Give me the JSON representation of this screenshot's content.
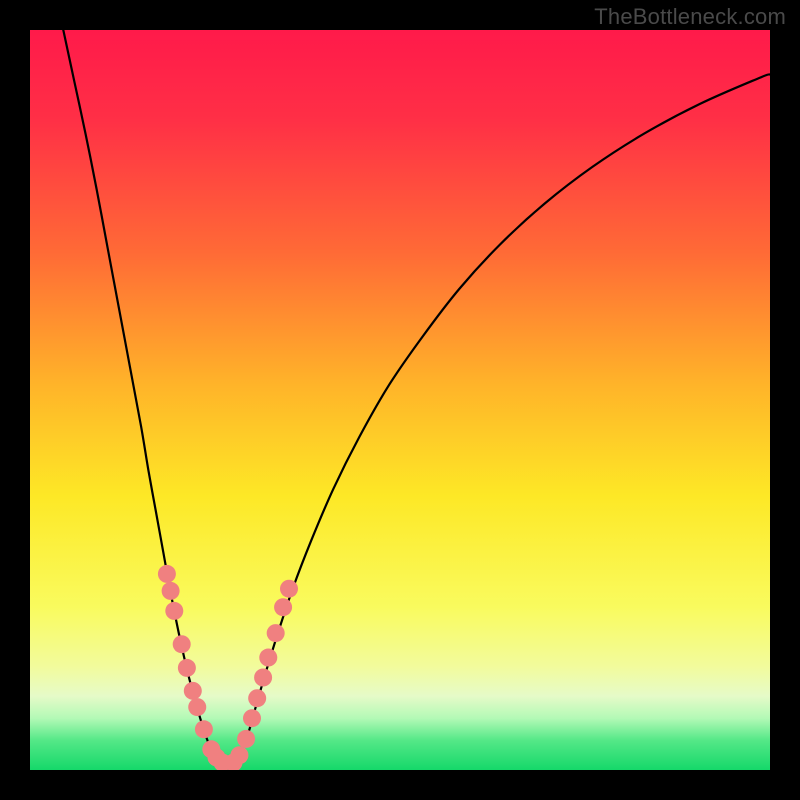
{
  "watermark": "TheBottleneck.com",
  "gradient_stops": [
    {
      "offset": 0.0,
      "color": "#ff1a4a"
    },
    {
      "offset": 0.12,
      "color": "#ff2f46"
    },
    {
      "offset": 0.3,
      "color": "#ff6a36"
    },
    {
      "offset": 0.48,
      "color": "#ffb429"
    },
    {
      "offset": 0.63,
      "color": "#fde826"
    },
    {
      "offset": 0.78,
      "color": "#f9fb5e"
    },
    {
      "offset": 0.86,
      "color": "#f2fb9c"
    },
    {
      "offset": 0.9,
      "color": "#e6fbc8"
    },
    {
      "offset": 0.93,
      "color": "#b3f9b6"
    },
    {
      "offset": 0.96,
      "color": "#54e887"
    },
    {
      "offset": 1.0,
      "color": "#15d86a"
    }
  ],
  "curves": {
    "left": {
      "name": "left-branch",
      "points": [
        {
          "x": 0.045,
          "y": 0.0
        },
        {
          "x": 0.06,
          "y": 0.07
        },
        {
          "x": 0.075,
          "y": 0.14
        },
        {
          "x": 0.09,
          "y": 0.215
        },
        {
          "x": 0.105,
          "y": 0.295
        },
        {
          "x": 0.12,
          "y": 0.375
        },
        {
          "x": 0.135,
          "y": 0.455
        },
        {
          "x": 0.15,
          "y": 0.535
        },
        {
          "x": 0.16,
          "y": 0.595
        },
        {
          "x": 0.17,
          "y": 0.65
        },
        {
          "x": 0.18,
          "y": 0.705
        },
        {
          "x": 0.19,
          "y": 0.76
        },
        {
          "x": 0.2,
          "y": 0.81
        },
        {
          "x": 0.21,
          "y": 0.855
        },
        {
          "x": 0.22,
          "y": 0.895
        },
        {
          "x": 0.23,
          "y": 0.93
        },
        {
          "x": 0.238,
          "y": 0.955
        },
        {
          "x": 0.245,
          "y": 0.972
        },
        {
          "x": 0.252,
          "y": 0.983
        },
        {
          "x": 0.26,
          "y": 0.99
        }
      ]
    },
    "right": {
      "name": "right-branch",
      "points": [
        {
          "x": 0.275,
          "y": 0.99
        },
        {
          "x": 0.285,
          "y": 0.975
        },
        {
          "x": 0.295,
          "y": 0.95
        },
        {
          "x": 0.305,
          "y": 0.915
        },
        {
          "x": 0.318,
          "y": 0.87
        },
        {
          "x": 0.335,
          "y": 0.815
        },
        {
          "x": 0.355,
          "y": 0.755
        },
        {
          "x": 0.38,
          "y": 0.69
        },
        {
          "x": 0.41,
          "y": 0.62
        },
        {
          "x": 0.445,
          "y": 0.55
        },
        {
          "x": 0.485,
          "y": 0.48
        },
        {
          "x": 0.53,
          "y": 0.415
        },
        {
          "x": 0.58,
          "y": 0.35
        },
        {
          "x": 0.635,
          "y": 0.29
        },
        {
          "x": 0.695,
          "y": 0.235
        },
        {
          "x": 0.76,
          "y": 0.185
        },
        {
          "x": 0.83,
          "y": 0.14
        },
        {
          "x": 0.905,
          "y": 0.1
        },
        {
          "x": 0.985,
          "y": 0.065
        },
        {
          "x": 1.0,
          "y": 0.06
        }
      ]
    }
  },
  "markers": {
    "color": "#f08080",
    "radius_px": 9,
    "points": [
      {
        "x": 0.185,
        "y": 0.735
      },
      {
        "x": 0.19,
        "y": 0.758
      },
      {
        "x": 0.195,
        "y": 0.785
      },
      {
        "x": 0.205,
        "y": 0.83
      },
      {
        "x": 0.212,
        "y": 0.862
      },
      {
        "x": 0.22,
        "y": 0.893
      },
      {
        "x": 0.226,
        "y": 0.915
      },
      {
        "x": 0.235,
        "y": 0.945
      },
      {
        "x": 0.245,
        "y": 0.972
      },
      {
        "x": 0.252,
        "y": 0.983
      },
      {
        "x": 0.26,
        "y": 0.99
      },
      {
        "x": 0.275,
        "y": 0.99
      },
      {
        "x": 0.283,
        "y": 0.98
      },
      {
        "x": 0.292,
        "y": 0.958
      },
      {
        "x": 0.3,
        "y": 0.93
      },
      {
        "x": 0.307,
        "y": 0.903
      },
      {
        "x": 0.315,
        "y": 0.875
      },
      {
        "x": 0.322,
        "y": 0.848
      },
      {
        "x": 0.332,
        "y": 0.815
      },
      {
        "x": 0.342,
        "y": 0.78
      },
      {
        "x": 0.35,
        "y": 0.755
      }
    ]
  },
  "chart_data": {
    "type": "line",
    "title": "",
    "xlabel": "",
    "ylabel": "",
    "xlim": [
      0,
      1
    ],
    "ylim": [
      0,
      1
    ],
    "note": "V-shaped bottleneck chart. No axis labels or tick marks are shown on screen. Values below are normalized coordinates read from the rendered curves (x across width, y as height from bottom).",
    "series": [
      {
        "name": "left-branch",
        "x": [
          0.045,
          0.06,
          0.075,
          0.09,
          0.105,
          0.12,
          0.135,
          0.15,
          0.16,
          0.17,
          0.18,
          0.19,
          0.2,
          0.21,
          0.22,
          0.23,
          0.238,
          0.245,
          0.252,
          0.26
        ],
        "y": [
          1.0,
          0.93,
          0.86,
          0.785,
          0.705,
          0.625,
          0.545,
          0.465,
          0.405,
          0.35,
          0.295,
          0.24,
          0.19,
          0.145,
          0.105,
          0.07,
          0.045,
          0.028,
          0.017,
          0.01
        ]
      },
      {
        "name": "right-branch",
        "x": [
          0.275,
          0.285,
          0.295,
          0.305,
          0.318,
          0.335,
          0.355,
          0.38,
          0.41,
          0.445,
          0.485,
          0.53,
          0.58,
          0.635,
          0.695,
          0.76,
          0.83,
          0.905,
          0.985,
          1.0
        ],
        "y": [
          0.01,
          0.025,
          0.05,
          0.085,
          0.13,
          0.185,
          0.245,
          0.31,
          0.38,
          0.45,
          0.52,
          0.585,
          0.65,
          0.71,
          0.765,
          0.815,
          0.86,
          0.9,
          0.935,
          0.94
        ]
      },
      {
        "name": "markers",
        "x": [
          0.185,
          0.19,
          0.195,
          0.205,
          0.212,
          0.22,
          0.226,
          0.235,
          0.245,
          0.252,
          0.26,
          0.275,
          0.283,
          0.292,
          0.3,
          0.307,
          0.315,
          0.322,
          0.332,
          0.342,
          0.35
        ],
        "y": [
          0.265,
          0.242,
          0.215,
          0.17,
          0.138,
          0.107,
          0.085,
          0.055,
          0.028,
          0.017,
          0.01,
          0.01,
          0.02,
          0.042,
          0.07,
          0.097,
          0.125,
          0.152,
          0.185,
          0.22,
          0.245
        ]
      }
    ]
  }
}
